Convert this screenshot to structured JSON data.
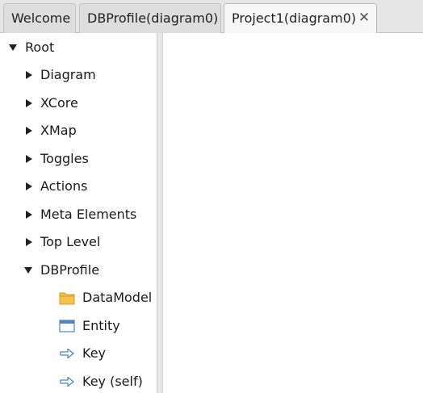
{
  "tabs": [
    {
      "label": "Welcome"
    },
    {
      "label": "DBProfile(diagram0)"
    },
    {
      "label": "Project1(diagram0)",
      "close": "✕"
    }
  ],
  "tree": {
    "root": "Root",
    "children": [
      "Diagram",
      "XCore",
      "XMap",
      "Toggles",
      "Actions",
      "Meta Elements",
      "Top Level",
      "DBProfile"
    ],
    "dbprofile_children": [
      {
        "label": "DataModel",
        "icon": "folder-icon"
      },
      {
        "label": "Entity",
        "icon": "window-icon"
      },
      {
        "label": "Key",
        "icon": "arrow-right-icon"
      },
      {
        "label": "Key (self)",
        "icon": "arrow-right-icon"
      }
    ]
  },
  "colors": {
    "folder": "#f5c24b",
    "folder_border": "#d49a22",
    "window": "#4a86c8",
    "arrow": "#4a86c8"
  }
}
